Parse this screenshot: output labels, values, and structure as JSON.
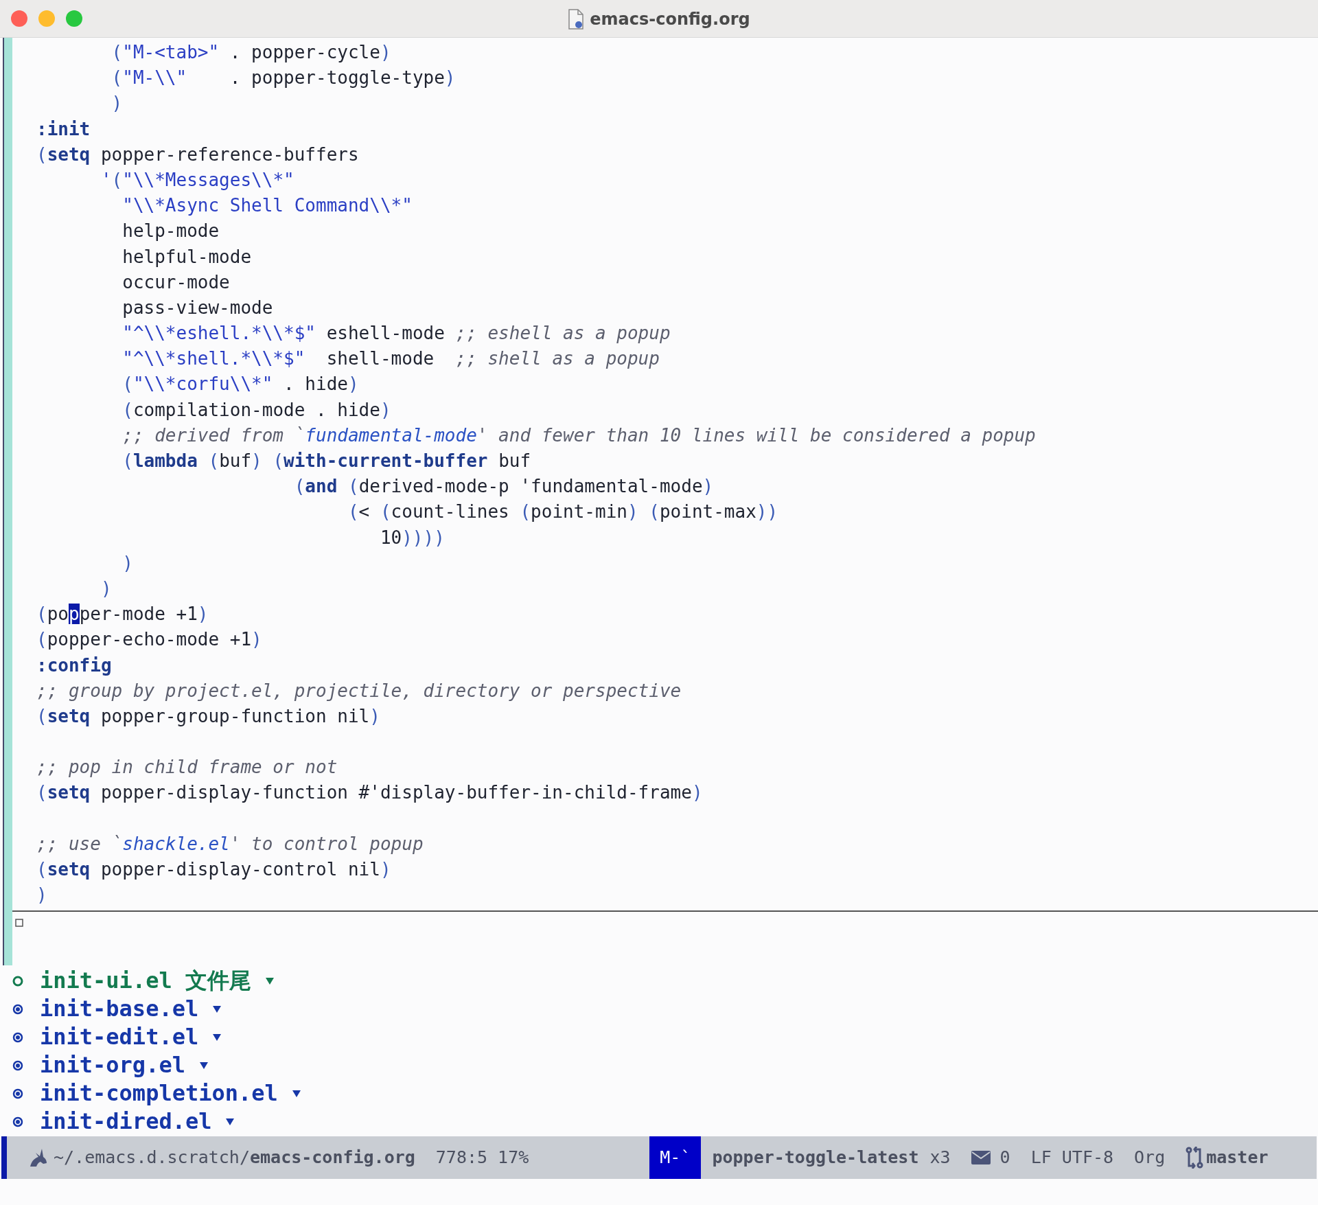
{
  "window": {
    "title": "emacs-config.org"
  },
  "code_lines": [
    {
      "segments": [
        {
          "kind": "paren",
          "text": "       ("
        },
        {
          "kind": "string",
          "text": "\"M-<tab>\""
        },
        {
          "kind": "plain",
          "text": " . popper-cycle"
        },
        {
          "kind": "paren",
          "text": ")"
        }
      ]
    },
    {
      "segments": [
        {
          "kind": "paren",
          "text": "       ("
        },
        {
          "kind": "string",
          "text": "\"M-\\\\\""
        },
        {
          "kind": "plain",
          "text": "    . popper-toggle-type"
        },
        {
          "kind": "paren",
          "text": ")"
        }
      ]
    },
    {
      "segments": [
        {
          "kind": "paren",
          "text": "       )"
        }
      ]
    },
    {
      "segments": [
        {
          "kind": "keyword",
          "text": ":init"
        }
      ]
    },
    {
      "segments": [
        {
          "kind": "paren",
          "text": "("
        },
        {
          "kind": "keyword",
          "text": "setq"
        },
        {
          "kind": "plain",
          "text": " popper-reference-buffers"
        }
      ]
    },
    {
      "segments": [
        {
          "kind": "string",
          "text": "      '"
        },
        {
          "kind": "paren",
          "text": "("
        },
        {
          "kind": "string",
          "text": "\"\\\\*Messages\\\\*\""
        }
      ]
    },
    {
      "segments": [
        {
          "kind": "string",
          "text": "        \"\\\\*Async Shell Command\\\\*\""
        }
      ]
    },
    {
      "segments": [
        {
          "kind": "plain",
          "text": "        help-mode"
        }
      ]
    },
    {
      "segments": [
        {
          "kind": "plain",
          "text": "        helpful-mode"
        }
      ]
    },
    {
      "segments": [
        {
          "kind": "plain",
          "text": "        occur-mode"
        }
      ]
    },
    {
      "segments": [
        {
          "kind": "plain",
          "text": "        pass-view-mode"
        }
      ]
    },
    {
      "segments": [
        {
          "kind": "string",
          "text": "        \"^\\\\*eshell.*\\\\*$\""
        },
        {
          "kind": "plain",
          "text": " eshell-mode "
        },
        {
          "kind": "comment",
          "text": ";; eshell as a popup"
        }
      ]
    },
    {
      "segments": [
        {
          "kind": "string",
          "text": "        \"^\\\\*shell.*\\\\*$\""
        },
        {
          "kind": "plain",
          "text": "  shell-mode  "
        },
        {
          "kind": "comment",
          "text": ";; shell as a popup"
        }
      ]
    },
    {
      "segments": [
        {
          "kind": "paren",
          "text": "        ("
        },
        {
          "kind": "string",
          "text": "\"\\\\*corfu\\\\*\""
        },
        {
          "kind": "plain",
          "text": " . hide"
        },
        {
          "kind": "paren",
          "text": ")"
        }
      ]
    },
    {
      "segments": [
        {
          "kind": "paren",
          "text": "        ("
        },
        {
          "kind": "plain",
          "text": "compilation-mode . hide"
        },
        {
          "kind": "paren",
          "text": ")"
        }
      ]
    },
    {
      "segments": [
        {
          "kind": "comment",
          "text": "        ;; derived from `"
        },
        {
          "kind": "reference",
          "text": "fundamental-mode"
        },
        {
          "kind": "comment",
          "text": "' and fewer than 10 lines will be considered a popup"
        }
      ]
    },
    {
      "segments": [
        {
          "kind": "paren",
          "text": "        ("
        },
        {
          "kind": "keyword",
          "text": "lambda"
        },
        {
          "kind": "paren",
          "text": " ("
        },
        {
          "kind": "plain",
          "text": "buf"
        },
        {
          "kind": "paren",
          "text": ") ("
        },
        {
          "kind": "keyword",
          "text": "with-current-buffer"
        },
        {
          "kind": "plain",
          "text": " buf"
        }
      ]
    },
    {
      "segments": [
        {
          "kind": "paren",
          "text": "                        ("
        },
        {
          "kind": "keyword",
          "text": "and"
        },
        {
          "kind": "paren",
          "text": " ("
        },
        {
          "kind": "plain",
          "text": "derived-mode-p 'fundamental-mode"
        },
        {
          "kind": "paren",
          "text": ")"
        }
      ]
    },
    {
      "segments": [
        {
          "kind": "paren",
          "text": "                             ("
        },
        {
          "kind": "plain",
          "text": "< "
        },
        {
          "kind": "paren",
          "text": "("
        },
        {
          "kind": "plain",
          "text": "count-lines "
        },
        {
          "kind": "paren",
          "text": "("
        },
        {
          "kind": "plain",
          "text": "point-min"
        },
        {
          "kind": "paren",
          "text": ") ("
        },
        {
          "kind": "plain",
          "text": "point-max"
        },
        {
          "kind": "paren",
          "text": "))"
        }
      ]
    },
    {
      "segments": [
        {
          "kind": "plain",
          "text": "                                10"
        },
        {
          "kind": "paren",
          "text": "))))"
        }
      ]
    },
    {
      "segments": [
        {
          "kind": "paren",
          "text": "        )"
        }
      ]
    },
    {
      "segments": [
        {
          "kind": "paren",
          "text": "      )"
        }
      ]
    },
    {
      "segments": [
        {
          "kind": "paren",
          "text": "("
        },
        {
          "kind": "plain",
          "text": "po"
        },
        {
          "kind": "cursor",
          "text": "p"
        },
        {
          "kind": "plain",
          "text": "per-mode +1"
        },
        {
          "kind": "paren",
          "text": ")"
        }
      ]
    },
    {
      "segments": [
        {
          "kind": "paren",
          "text": "("
        },
        {
          "kind": "plain",
          "text": "popper-echo-mode +1"
        },
        {
          "kind": "paren",
          "text": ")"
        }
      ]
    },
    {
      "segments": [
        {
          "kind": "keyword",
          "text": ":config"
        }
      ]
    },
    {
      "segments": [
        {
          "kind": "comment",
          "text": ";; group by project.el, projectile, directory or perspective"
        }
      ]
    },
    {
      "segments": [
        {
          "kind": "paren",
          "text": "("
        },
        {
          "kind": "keyword",
          "text": "setq"
        },
        {
          "kind": "plain",
          "text": " popper-group-function nil"
        },
        {
          "kind": "paren",
          "text": ")"
        }
      ]
    },
    {
      "kind": "blank"
    },
    {
      "segments": [
        {
          "kind": "comment",
          "text": ";; pop in child frame or not"
        }
      ]
    },
    {
      "segments": [
        {
          "kind": "paren",
          "text": "("
        },
        {
          "kind": "keyword",
          "text": "setq"
        },
        {
          "kind": "plain",
          "text": " popper-display-function #'display-buffer-in-child-frame"
        },
        {
          "kind": "paren",
          "text": ")"
        }
      ]
    },
    {
      "kind": "blank"
    },
    {
      "segments": [
        {
          "kind": "comment",
          "text": ";; use `"
        },
        {
          "kind": "reference",
          "text": "shackle.el"
        },
        {
          "kind": "comment",
          "text": "' to control popup"
        }
      ]
    },
    {
      "segments": [
        {
          "kind": "paren",
          "text": "("
        },
        {
          "kind": "keyword",
          "text": "setq"
        },
        {
          "kind": "plain",
          "text": " popper-display-control nil"
        },
        {
          "kind": "paren",
          "text": ")"
        }
      ]
    },
    {
      "segments": [
        {
          "kind": "paren",
          "text": ")"
        }
      ]
    }
  ],
  "outline": [
    {
      "label": "init-ui.el 文件尾",
      "current": true
    },
    {
      "label": "init-base.el",
      "current": false
    },
    {
      "label": "init-edit.el",
      "current": false
    },
    {
      "label": "init-org.el",
      "current": false
    },
    {
      "label": "init-completion.el",
      "current": false
    },
    {
      "label": "init-dired.el",
      "current": false
    }
  ],
  "mode_line": {
    "path": "~/.emacs.d.scratch/**emacs-config.org**",
    "position": "778:5 17%",
    "key": "M-`",
    "command": "popper-toggle-latest",
    "repeat": "x3",
    "mail_count": "0",
    "encoding": "LF UTF-8",
    "major_mode": "Org",
    "branch": "master"
  }
}
